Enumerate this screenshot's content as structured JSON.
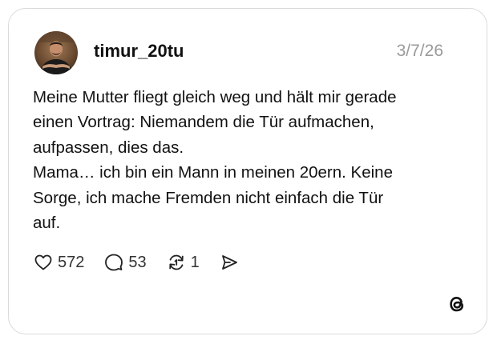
{
  "post": {
    "username": "timur_20tu",
    "date": "3/7/26",
    "avatar_icon": "profile-photo",
    "text_lines": [
      "Meine Mutter fliegt gleich weg und hält mir gerade",
      "einen Vortrag: Niemandem die Tür aufmachen,",
      "aufpassen, dies das.",
      "Mama… ich bin ein Mann in meinen 20ern. Keine",
      "Sorge, ich mache Fremden nicht einfach die Tür",
      "auf."
    ]
  },
  "actions": {
    "like_count": "572",
    "comment_count": "53",
    "repost_count": "1",
    "like_icon": "heart-icon",
    "comment_icon": "comment-bubble-icon",
    "repost_icon": "repost-icon",
    "share_icon": "send-icon"
  },
  "brand": {
    "logo": "threads-logo-icon"
  },
  "colors": {
    "text": "#111111",
    "muted": "#9a9a9a",
    "border": "#dadada",
    "background": "#ffffff"
  }
}
